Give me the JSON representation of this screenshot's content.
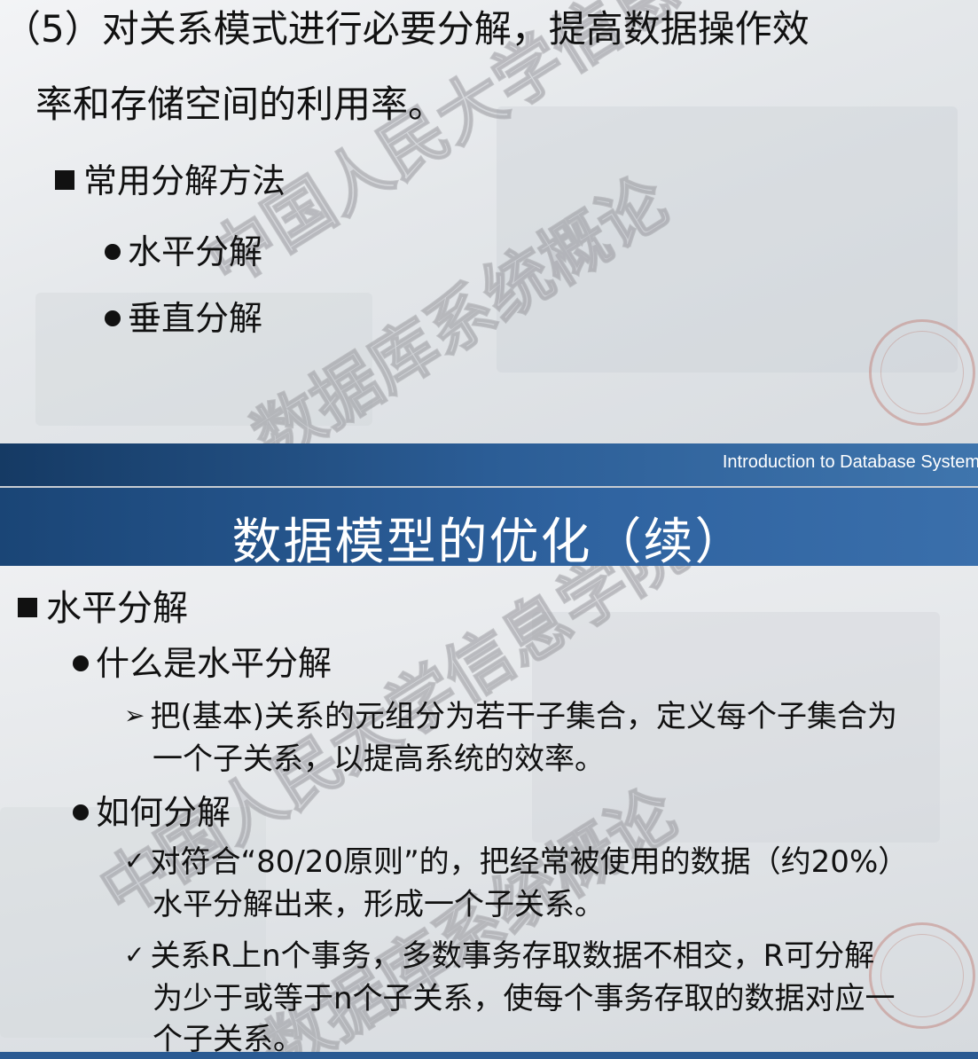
{
  "top_slide": {
    "heading_line1": "（5）对关系模式进行必要分解，提高数据操作效",
    "heading_line2": "率和存储空间的利用率。",
    "bullet": "常用分解方法",
    "sub_bullets": [
      "水平分解",
      "垂直分解"
    ],
    "footer_band_text": "Introduction to Database System"
  },
  "bottom_slide": {
    "title": "数据模型的优化（续）",
    "bullet": "水平分解",
    "sub1": "什么是水平分解",
    "sub1_items": [
      {
        "line1": "把(基本)关系的元组分为若干子集合，定义每个子集合为",
        "line2": "一个子关系，以提高系统的效率。"
      }
    ],
    "sub2": "如何分解",
    "sub2_items": [
      {
        "line1": "对符合“80/20原则”的，把经常被使用的数据（约20%）",
        "line2": "水平分解出来，形成一个子关系。"
      },
      {
        "line1": "关系R上n个事务，多数事务存取数据不相交，R可分解",
        "line2": "为少于或等于n个子关系，使每个事务存取的数据对应一",
        "line3": "个子关系。"
      }
    ]
  },
  "colors": {
    "band_blue": "#2b5d96",
    "title_blue": "#2f63a0",
    "text": "#111111"
  },
  "watermarks": [
    "数据库系统概论",
    "中国人民大学信息学院"
  ]
}
